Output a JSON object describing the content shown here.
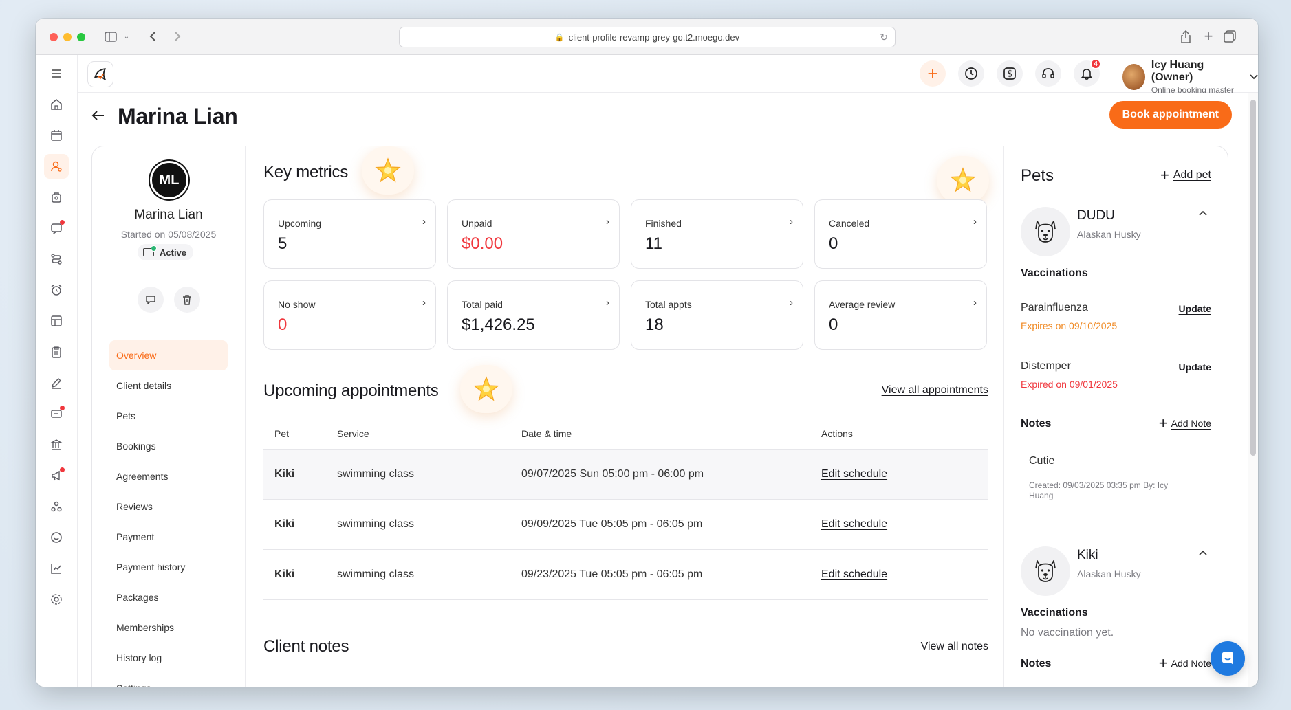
{
  "browser": {
    "url": "client-profile-revamp-grey-go.t2.moego.dev"
  },
  "header": {
    "notifications_count": "4",
    "user_name": "Icy Huang (Owner)",
    "user_role": "Online booking master"
  },
  "page": {
    "title": "Marina Lian",
    "book_button": "Book appointment"
  },
  "profile": {
    "initials": "ML",
    "name": "Marina Lian",
    "started": "Started on 05/08/2025",
    "status": "Active",
    "nav": [
      {
        "label": "Overview"
      },
      {
        "label": "Client details"
      },
      {
        "label": "Pets"
      },
      {
        "label": "Bookings"
      },
      {
        "label": "Agreements"
      },
      {
        "label": "Reviews"
      },
      {
        "label": "Payment"
      },
      {
        "label": "Payment history"
      },
      {
        "label": "Packages"
      },
      {
        "label": "Memberships"
      },
      {
        "label": "History log"
      },
      {
        "label": "Settings"
      }
    ]
  },
  "metrics": {
    "title": "Key metrics",
    "items": [
      {
        "label": "Upcoming",
        "value": "5"
      },
      {
        "label": "Unpaid",
        "value": "$0.00"
      },
      {
        "label": "Finished",
        "value": "11"
      },
      {
        "label": "Canceled",
        "value": "0"
      },
      {
        "label": "No show",
        "value": "0"
      },
      {
        "label": "Total paid",
        "value": "$1,426.25"
      },
      {
        "label": "Total appts",
        "value": "18"
      },
      {
        "label": "Average review",
        "value": "0"
      }
    ]
  },
  "upcoming": {
    "title": "Upcoming appointments",
    "view_all": "View all appointments",
    "columns": [
      "Pet",
      "Service",
      "Date & time",
      "Actions"
    ],
    "rows": [
      {
        "pet": "Kiki",
        "service": "swimming class",
        "datetime": "09/07/2025 Sun 05:00 pm - 06:00 pm",
        "action": "Edit schedule"
      },
      {
        "pet": "Kiki",
        "service": "swimming class",
        "datetime": "09/09/2025 Tue 05:05 pm - 06:05 pm",
        "action": "Edit schedule"
      },
      {
        "pet": "Kiki",
        "service": "swimming class",
        "datetime": "09/23/2025 Tue 05:05 pm - 06:05 pm",
        "action": "Edit schedule"
      }
    ]
  },
  "client_notes": {
    "title": "Client notes",
    "view_all": "View all notes"
  },
  "pets": {
    "title": "Pets",
    "add_pet": "Add pet",
    "list": [
      {
        "name": "DUDU",
        "breed": "Alaskan Husky",
        "vaccinations_label": "Vaccinations",
        "vaccinations": [
          {
            "name": "Parainfluenza",
            "expiry": "Expires on 09/10/2025",
            "action": "Update"
          },
          {
            "name": "Distemper",
            "expiry": "Expired on 09/01/2025",
            "action": "Update"
          }
        ],
        "notes_label": "Notes",
        "add_note": "Add Note",
        "note": {
          "text": "Cutie",
          "meta": "Created: 09/03/2025 03:35 pm By: Icy Huang"
        }
      },
      {
        "name": "Kiki",
        "breed": "Alaskan Husky",
        "vaccinations_label": "Vaccinations",
        "no_vaccination": "No vaccination yet.",
        "notes_label": "Notes",
        "add_note": "Add Note"
      }
    ]
  },
  "colors": {
    "accent": "#f96b18",
    "danger": "#f0373d",
    "warning": "#f08a24"
  }
}
